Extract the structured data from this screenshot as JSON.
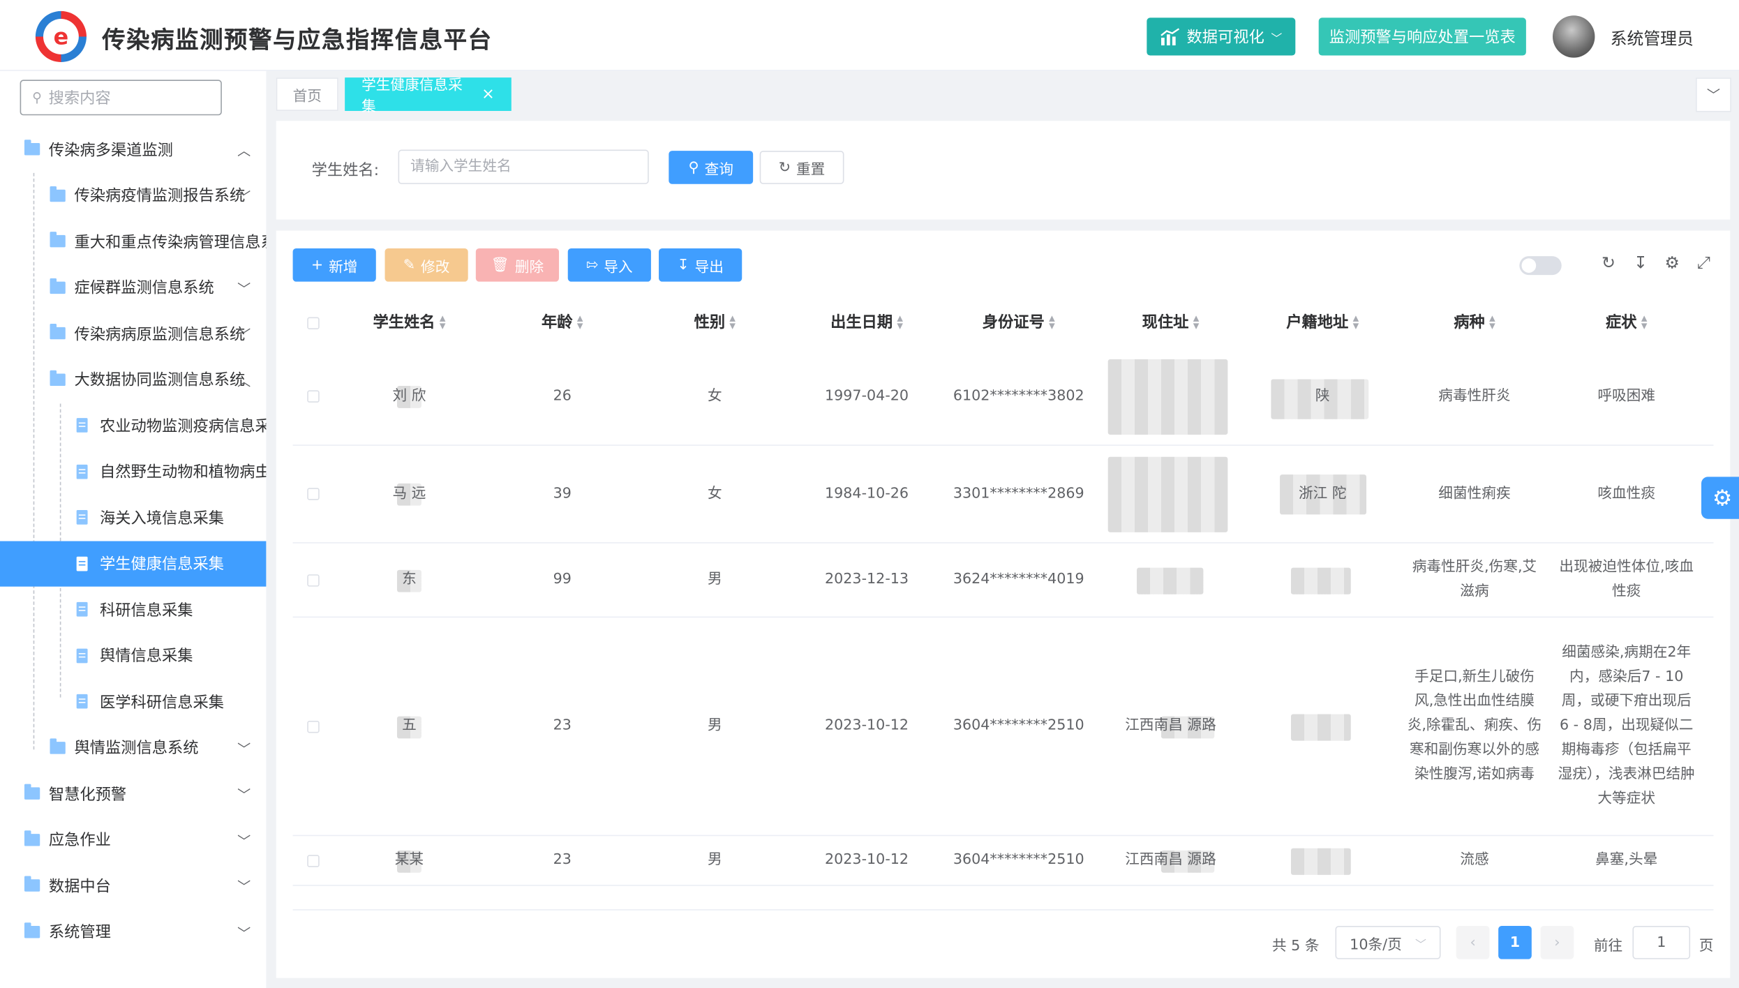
{
  "header": {
    "title": "传染病监测预警与应急指挥信息平台",
    "btn_visual": "数据可视化",
    "btn_monitor": "监测预警与响应处置一览表",
    "username": "系统管理员",
    "logo_letter": "e"
  },
  "sidebar": {
    "search_placeholder": "搜索内容",
    "items": [
      {
        "label": "传染病多渠道监测",
        "level": 0,
        "arrow": "^"
      },
      {
        "label": "传染病疫情监测报告系统",
        "level": 1,
        "arrow": "v"
      },
      {
        "label": "重大和重点传染病管理信息系",
        "level": 1,
        "arrow": ""
      },
      {
        "label": "症候群监测信息系统",
        "level": 1,
        "arrow": "v"
      },
      {
        "label": "传染病病原监测信息系统",
        "level": 1,
        "arrow": "v"
      },
      {
        "label": "大数据协同监测信息系统",
        "level": 1,
        "arrow": "^"
      },
      {
        "label": "农业动物监测疫病信息采集",
        "level": 2,
        "arrow": ""
      },
      {
        "label": "自然野生动物和植物病虫害",
        "level": 2,
        "arrow": ""
      },
      {
        "label": "海关入境信息采集",
        "level": 2,
        "arrow": ""
      },
      {
        "label": "学生健康信息采集",
        "level": 2,
        "arrow": "",
        "active": true
      },
      {
        "label": "科研信息采集",
        "level": 2,
        "arrow": ""
      },
      {
        "label": "舆情信息采集",
        "level": 2,
        "arrow": ""
      },
      {
        "label": "医学科研信息采集",
        "level": 2,
        "arrow": ""
      },
      {
        "label": "舆情监测信息系统",
        "level": 1,
        "arrow": "v"
      },
      {
        "label": "智慧化预警",
        "level": 0,
        "arrow": "v"
      },
      {
        "label": "应急作业",
        "level": 0,
        "arrow": "v"
      },
      {
        "label": "数据中台",
        "level": 0,
        "arrow": "v"
      },
      {
        "label": "系统管理",
        "level": 0,
        "arrow": "v"
      }
    ]
  },
  "tabs": {
    "home": "首页",
    "current": "学生健康信息采集",
    "close": "×"
  },
  "query": {
    "label": "学生姓名:",
    "placeholder": "请输入学生姓名",
    "search": "查询",
    "reset": "重置"
  },
  "toolbar": {
    "add": "新增",
    "edit": "修改",
    "delete": "删除",
    "import": "导入",
    "export": "导出"
  },
  "colors": {
    "primary": "#409eff",
    "edit": "#f6c98f",
    "delete": "#f9b3b3",
    "teal": "#20b2aa",
    "tab_active": "#2ee0e8"
  },
  "table": {
    "headers": [
      "学生姓名",
      "年龄",
      "性别",
      "出生日期",
      "身份证号",
      "现住址",
      "户籍地址",
      "病种",
      "症状"
    ],
    "rows": [
      {
        "name": "刘  欣",
        "age": "26",
        "gender": "女",
        "birth": "1997-04-20",
        "id": "6102********3802",
        "addr": "",
        "huji": "陕",
        "disease": "病毒性肝炎",
        "symptom": "呼吸困难"
      },
      {
        "name": "马  远",
        "age": "39",
        "gender": "女",
        "birth": "1984-10-26",
        "id": "3301********2869",
        "addr": "",
        "huji": "浙江                陀",
        "disease": "细菌性痢疾",
        "symptom": "咳血性痰"
      },
      {
        "name": "  东",
        "age": "99",
        "gender": "男",
        "birth": "2023-12-13",
        "id": "3624********4019",
        "addr": "",
        "huji": "",
        "disease": "病毒性肝炎,伤寒,艾滋病",
        "symptom": "出现被迫性体位,咳血性痰"
      },
      {
        "name": "  五",
        "age": "23",
        "gender": "男",
        "birth": "2023-10-12",
        "id": "3604********2510",
        "addr": "江西南昌        源路",
        "huji": "",
        "disease": "手足口,新生儿破伤风,急性出血性结膜炎,除霍乱、痢疾、伤寒和副伤寒以外的感染性腹泻,诺如病毒",
        "symptom": "细菌感染,病期在2年内，感染后7 - 10周，或硬下疳出现后6 - 8周，出现疑似二期梅毒疹（包括扁平湿疣），浅表淋巴结肿大等症状"
      },
      {
        "name": "  某某",
        "age": "23",
        "gender": "男",
        "birth": "2023-10-12",
        "id": "3604********2510",
        "addr": "江西南昌        源路",
        "huji": "",
        "disease": "流感",
        "symptom": "鼻塞,头晕"
      }
    ]
  },
  "pagination": {
    "total": "共 5 条",
    "size": "10条/页",
    "page": "1",
    "goto": "前往",
    "goto_val": "1",
    "unit": "页"
  }
}
